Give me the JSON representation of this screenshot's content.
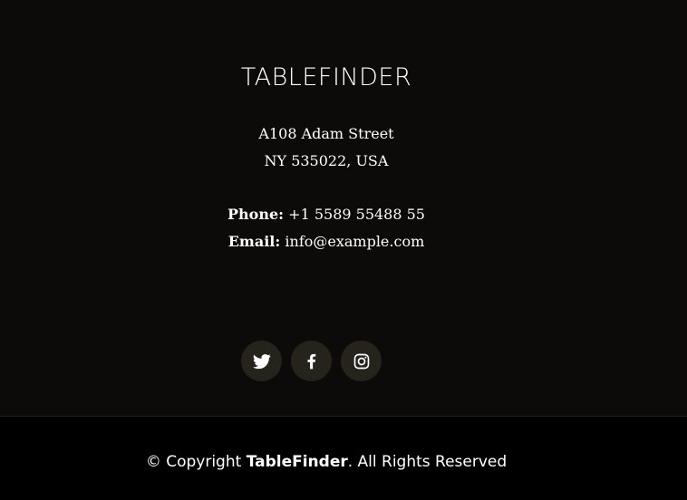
{
  "footer": {
    "brand": "TABLEFINDER",
    "address": {
      "line1": "A108 Adam Street",
      "line2": "NY 535022, USA"
    },
    "contact": {
      "phone_label": "Phone:",
      "phone_value": "+1 5589 55488 55",
      "email_label": "Email:",
      "email_value": "info@example.com"
    },
    "social": [
      {
        "name": "twitter",
        "icon": "twitter-icon"
      },
      {
        "name": "facebook",
        "icon": "facebook-icon"
      },
      {
        "name": "instagram",
        "icon": "instagram-icon"
      }
    ],
    "copyright": {
      "prefix": "© Copyright",
      "brand": "TableFinder",
      "suffix": ". All Rights Reserved"
    }
  },
  "colors": {
    "background_top": "#0c0b09",
    "background_bottom": "#000000",
    "social_button": "#26231d",
    "text": "#ffffff"
  }
}
